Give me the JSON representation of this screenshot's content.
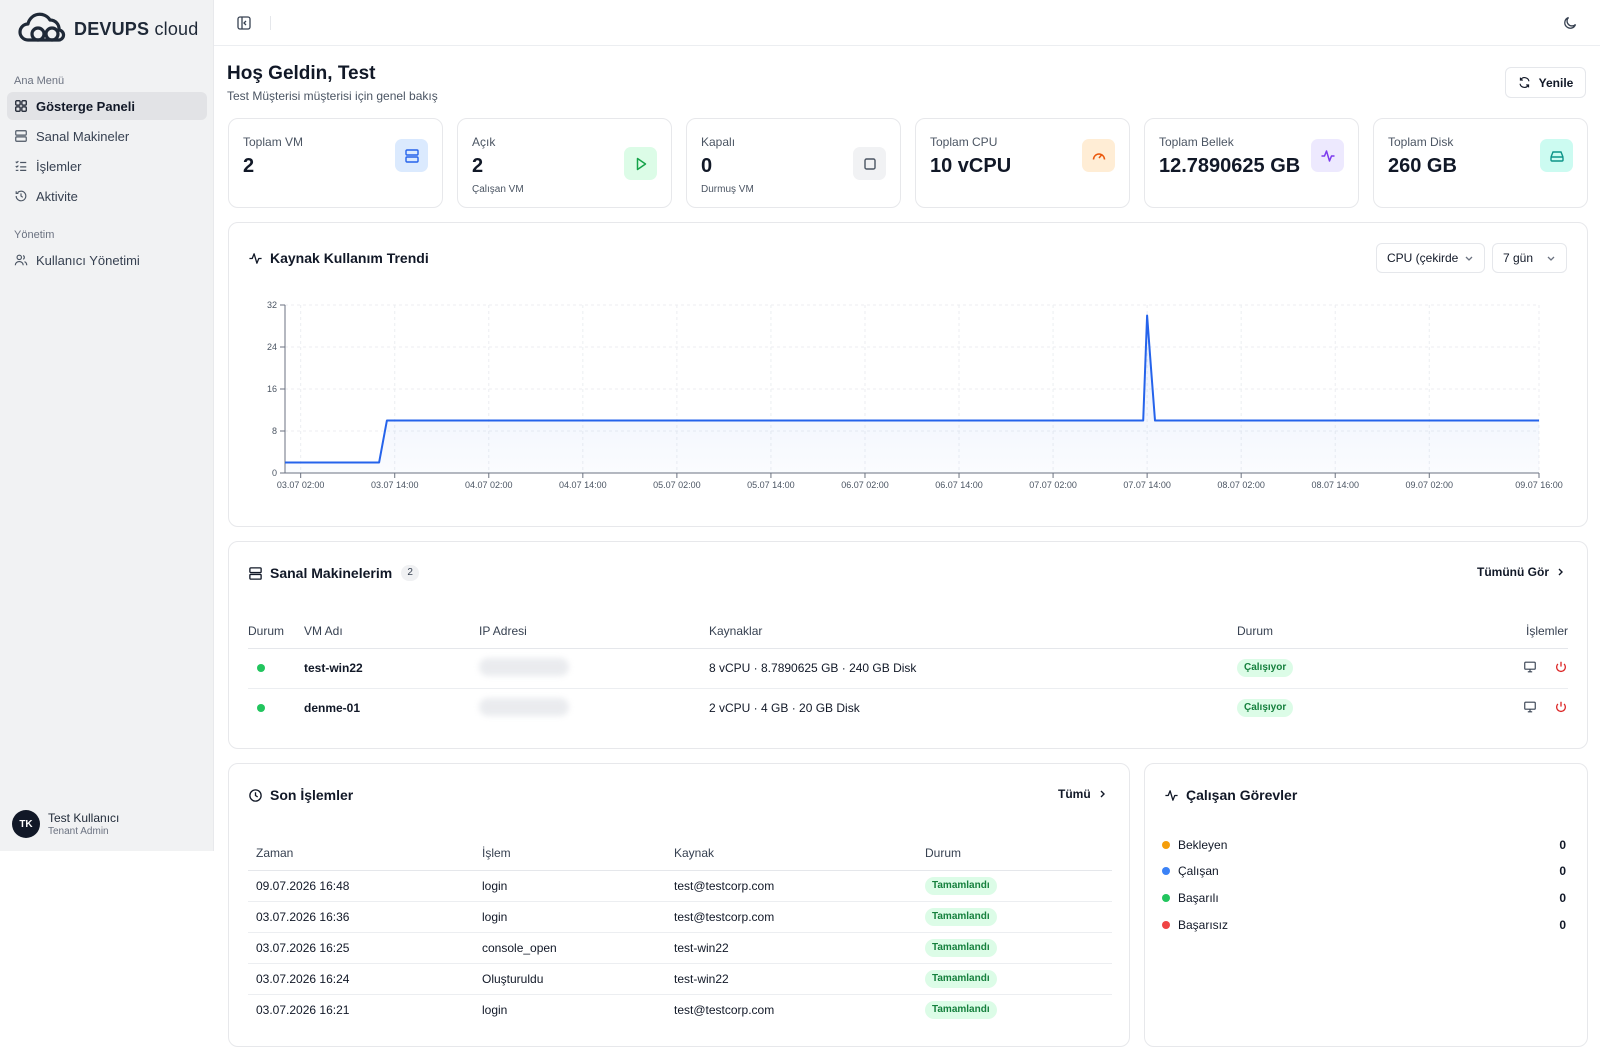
{
  "brand": {
    "name_bold": "DEVUPS",
    "name_light": "cloud"
  },
  "sidebar": {
    "groups": [
      {
        "title": "Ana Menü",
        "items": [
          {
            "label": "Gösterge Paneli",
            "icon": "dashboard-icon",
            "active": true
          },
          {
            "label": "Sanal Makineler",
            "icon": "server-icon"
          },
          {
            "label": "İşlemler",
            "icon": "list-checks-icon"
          },
          {
            "label": "Aktivite",
            "icon": "history-icon"
          }
        ]
      },
      {
        "title": "Yönetim",
        "items": [
          {
            "label": "Kullanıcı Yönetimi",
            "icon": "users-icon"
          }
        ]
      }
    ],
    "user": {
      "initials": "TK",
      "name": "Test Kullanıcı",
      "role": "Tenant Admin"
    }
  },
  "header": {
    "title": "Hoş Geldin, Test",
    "subtitle": "Test Müşterisi müşterisi için genel bakış",
    "refresh_label": "Yenile"
  },
  "stats": [
    {
      "label": "Toplam VM",
      "value": "2",
      "sub": "",
      "icon": "server-icon",
      "color": "#2563eb",
      "bg": "#dbeafe"
    },
    {
      "label": "Açık",
      "value": "2",
      "sub": "Çalışan VM",
      "icon": "play-icon",
      "color": "#16a34a",
      "bg": "#dcfce7"
    },
    {
      "label": "Kapalı",
      "value": "0",
      "sub": "Durmuş VM",
      "icon": "stop-icon",
      "color": "#4b5563",
      "bg": "#f1f2f4"
    },
    {
      "label": "Toplam CPU",
      "value": "10 vCPU",
      "sub": "",
      "icon": "gauge-icon",
      "color": "#ea580c",
      "bg": "#ffedd5"
    },
    {
      "label": "Toplam Bellek",
      "value": "12.7890625 GB",
      "sub": "",
      "icon": "activity-icon",
      "color": "#7c3aed",
      "bg": "#ede9fe"
    },
    {
      "label": "Toplam Disk",
      "value": "260 GB",
      "sub": "",
      "icon": "hard-drive-icon",
      "color": "#0d9488",
      "bg": "#ccfbf1"
    }
  ],
  "trend": {
    "title": "Kaynak Kullanım Trendi",
    "metric_select": "CPU (çekirde",
    "range_select": "7 gün"
  },
  "chart_data": {
    "type": "line",
    "color": "#2563eb",
    "ylim": [
      0,
      32
    ],
    "yticks": [
      0,
      8,
      16,
      24,
      32
    ],
    "xlim": [
      "03.07 00:00",
      "09.07 16:00"
    ],
    "xticks": [
      "03.07 02:00",
      "03.07 14:00",
      "04.07 02:00",
      "04.07 14:00",
      "05.07 02:00",
      "05.07 14:00",
      "06.07 02:00",
      "06.07 14:00",
      "07.07 02:00",
      "07.07 14:00",
      "08.07 02:00",
      "08.07 14:00",
      "09.07 02:00",
      "09.07 16:00"
    ],
    "x": [
      "03.07 00:00",
      "03.07 12:00",
      "03.07 13:00",
      "07.07 13:00",
      "07.07 13:30",
      "07.07 14:00",
      "07.07 14:30",
      "07.07 15:00",
      "09.07 16:00"
    ],
    "y": [
      2,
      2,
      10,
      10,
      10,
      30,
      20,
      10,
      10
    ]
  },
  "vms": {
    "title": "Sanal Makinelerim",
    "count": "2",
    "view_all": "Tümünü Gör",
    "columns": [
      "Durum",
      "VM Adı",
      "IP Adresi",
      "Kaynaklar",
      "Durum",
      "İşlemler"
    ],
    "rows": [
      {
        "name": "test-win22",
        "resources": "8 vCPU · 8.7890625 GB · 240 GB Disk",
        "status": "Çalışıyor"
      },
      {
        "name": "denme-01",
        "resources": "2 vCPU · 4 GB · 20 GB Disk",
        "status": "Çalışıyor"
      }
    ]
  },
  "ops": {
    "title": "Son İşlemler",
    "view_all": "Tümü",
    "columns": [
      "Zaman",
      "İşlem",
      "Kaynak",
      "Durum"
    ],
    "rows": [
      {
        "time": "09.07.2026 16:48",
        "op": "login",
        "source": "test@testcorp.com",
        "status": "Tamamlandı"
      },
      {
        "time": "03.07.2026 16:36",
        "op": "login",
        "source": "test@testcorp.com",
        "status": "Tamamlandı"
      },
      {
        "time": "03.07.2026 16:25",
        "op": "console_open",
        "source": "test-win22",
        "status": "Tamamlandı"
      },
      {
        "time": "03.07.2026 16:24",
        "op": "Oluşturuldu",
        "source": "test-win22",
        "status": "Tamamlandı"
      },
      {
        "time": "03.07.2026 16:21",
        "op": "login",
        "source": "test@testcorp.com",
        "status": "Tamamlandı"
      }
    ]
  },
  "tasks": {
    "title": "Çalışan Görevler",
    "items": [
      {
        "label": "Bekleyen",
        "value": "0",
        "color": "#f59e0b"
      },
      {
        "label": "Çalışan",
        "value": "0",
        "color": "#3b82f6"
      },
      {
        "label": "Başarılı",
        "value": "0",
        "color": "#22c55e"
      },
      {
        "label": "Başarısız",
        "value": "0",
        "color": "#ef4444"
      }
    ]
  }
}
